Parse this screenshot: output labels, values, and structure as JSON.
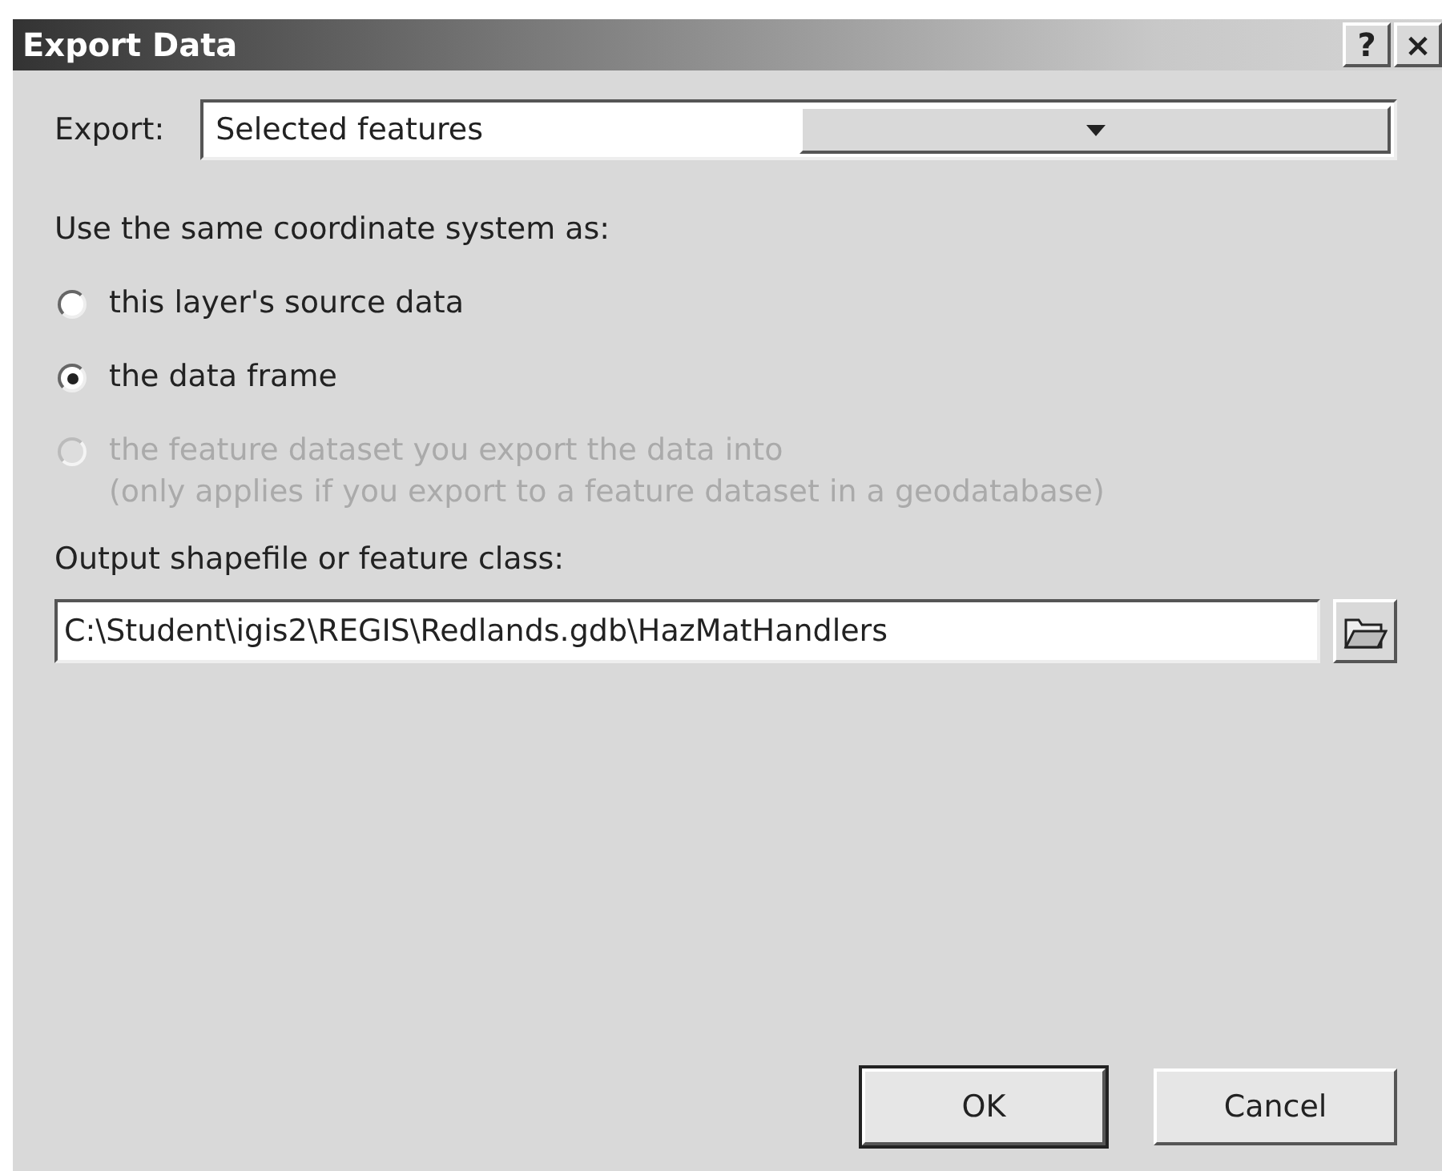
{
  "window": {
    "title": "Export Data",
    "title_buttons": [
      "?",
      "×"
    ]
  },
  "export": {
    "label": "Export:",
    "value": "Selected features"
  },
  "coordinate_system": {
    "label": "Use the same coordinate system as:",
    "options": [
      {
        "label": "this layer's source data",
        "selected": false,
        "disabled": false
      },
      {
        "label": "the data frame",
        "selected": true,
        "disabled": false
      },
      {
        "label": "the feature dataset you export the data into",
        "note": "(only applies if you export to a feature dataset in a geodatabase)",
        "selected": false,
        "disabled": true
      }
    ]
  },
  "output": {
    "label": "Output shapefile or feature class:",
    "value": "C:\\Student\\igis2\\REGIS\\Redlands.gdb\\HazMatHandlers"
  },
  "buttons": [
    {
      "label": "OK",
      "default": true
    },
    {
      "label": "Cancel",
      "default": false
    }
  ]
}
